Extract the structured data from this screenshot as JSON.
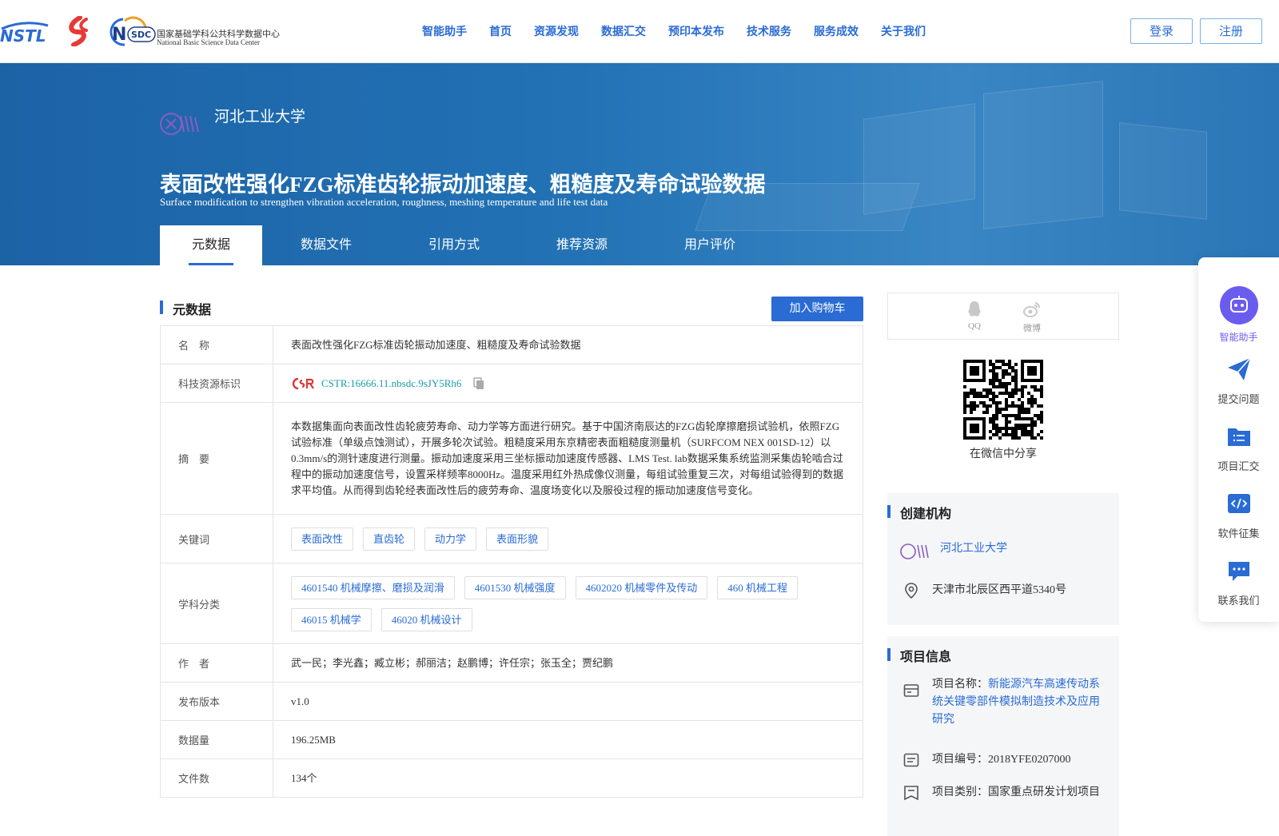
{
  "nav": {
    "logos": {
      "nstl": "NSTL",
      "nsdc_badge": "SDC",
      "nsdc_cn": "国家基础学科公共科学数据中心",
      "nsdc_en": "National Basic Science Data Center"
    },
    "items": [
      "智能助手",
      "首页",
      "资源发现",
      "数据汇交",
      "预印本发布",
      "技术服务",
      "服务成效",
      "关于我们"
    ],
    "login": "登录",
    "register": "注册"
  },
  "hero": {
    "institution": "河北工业大学",
    "title": "表面改性强化FZG标准齿轮振动加速度、粗糙度及寿命试验数据",
    "subtitle": "Surface modification to strengthen vibration acceleration, roughness, meshing temperature and life test data",
    "tabs": [
      "元数据",
      "数据文件",
      "引用方式",
      "推荐资源",
      "用户评价"
    ]
  },
  "metadata": {
    "section_title": "元数据",
    "cart_button": "加入购物车",
    "rows": {
      "name": {
        "label": "名　称",
        "value": "表面改性强化FZG标准齿轮振动加速度、粗糙度及寿命试验数据"
      },
      "cstr": {
        "label": "科技资源标识",
        "value": "CSTR:16666.11.nbsdc.9sJY5Rh6"
      },
      "abstract": {
        "label": "摘　要",
        "value": "本数据集面向表面改性齿轮疲劳寿命、动力学等方面进行研究。基于中国济南辰达的FZG齿轮摩擦磨损试验机，依照FZG试验标准（单级点蚀测试），开展多轮次试验。粗糙度采用东京精密表面粗糙度测量机（SURFCOM NEX 001SD-12）以0.3mm/s的测针速度进行测量。振动加速度采用三坐标振动加速度传感器、LMS Test. lab数据采集系统监测采集齿轮啮合过程中的振动加速度信号，设置采样频率8000Hz。温度采用红外热成像仪测量，每组试验重复三次，对每组试验得到的数据求平均值。从而得到齿轮经表面改性后的疲劳寿命、温度场变化以及服役过程的振动加速度信号变化。"
      },
      "keywords": {
        "label": "关键词",
        "tags": [
          "表面改性",
          "直齿轮",
          "动力学",
          "表面形貌"
        ]
      },
      "subjects": {
        "label": "学科分类",
        "tags": [
          "4601540 机械摩擦、磨损及润滑",
          "4601530 机械强度",
          "4602020 机械零件及传动",
          "460 机械工程",
          "46015 机械学",
          "46020 机械设计"
        ]
      },
      "authors": {
        "label": "作　者",
        "value": "武一民；李光鑫；臧立彬；郝丽洁；赵鹏博；许任宗；张玉全；贾纪鹏"
      },
      "version": {
        "label": "发布版本",
        "value": "v1.0"
      },
      "size": {
        "label": "数据量",
        "value": "196.25MB"
      },
      "files": {
        "label": "文件数",
        "value": "134个"
      }
    }
  },
  "side": {
    "share": {
      "qq": "QQ",
      "weibo": "微博",
      "wechat_caption": "在微信中分享"
    },
    "creator": {
      "title": "创建机构",
      "name": "河北工业大学",
      "address": "天津市北辰区西平道5340号"
    },
    "project": {
      "title": "项目信息",
      "name_label": "项目名称：",
      "name_value": "新能源汽车高速传动系统关键零部件模拟制造技术及应用研究",
      "code": "项目编号：2018YFE0207000",
      "category": "项目类别：国家重点研发计划项目"
    }
  },
  "float": [
    "智能助手",
    "提交问题",
    "项目汇交",
    "软件征集",
    "联系我们"
  ],
  "colors": {
    "brand": "#2a6bd4",
    "hero": "#1f68aa",
    "assistant": "#6b5cf0"
  }
}
